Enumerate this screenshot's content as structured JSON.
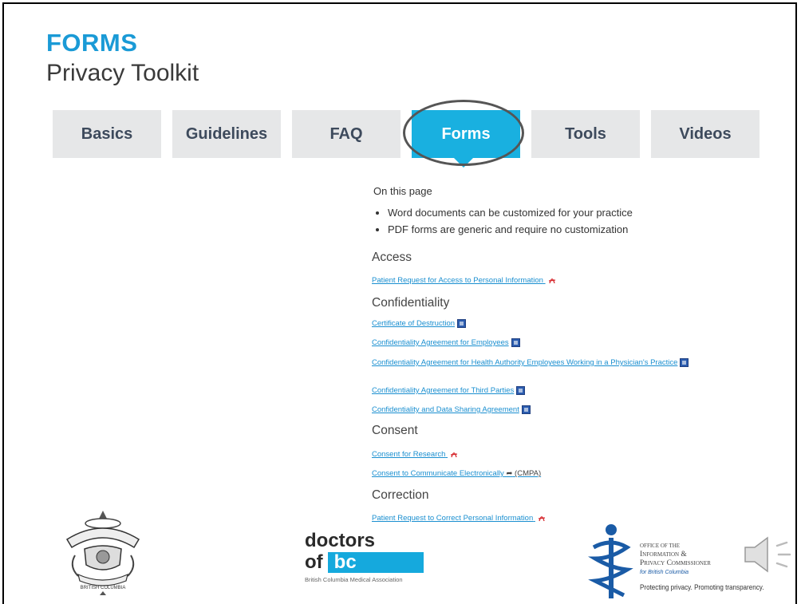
{
  "header": {
    "title": "FORMS",
    "subtitle": "Privacy Toolkit"
  },
  "tabs": [
    {
      "label": "Basics",
      "active": false
    },
    {
      "label": "Guidelines",
      "active": false
    },
    {
      "label": "FAQ",
      "active": false
    },
    {
      "label": "Forms",
      "active": true
    },
    {
      "label": "Tools",
      "active": false
    },
    {
      "label": "Videos",
      "active": false
    }
  ],
  "content": {
    "on_this_page": "On this page",
    "bullets": [
      "Word documents can be customized for your practice",
      "PDF forms are generic and require no customization"
    ],
    "sections": {
      "access": {
        "heading": "Access",
        "links": [
          "Patient Request for Access to Personal Information"
        ]
      },
      "confidentiality": {
        "heading": "Confidentiality",
        "links": [
          "Certificate of Destruction",
          "Confidentiality Agreement for Employees",
          "Confidentiality Agreement for Health Authority Employees Working in a Physician's Practice",
          "Confidentiality Agreement for Third Parties",
          "Confidentiality and Data Sharing Agreement"
        ]
      },
      "consent": {
        "heading": "Consent",
        "links": [
          "Consent for Research",
          "Consent to Communicate Electronically"
        ],
        "cmpa_note": "(CMPA)"
      },
      "correction": {
        "heading": "Correction",
        "links": [
          "Patient Request to Correct Personal Information"
        ]
      }
    }
  },
  "logos": {
    "doctors_line1": "doctors",
    "doctors_of": "of",
    "doctors_bc": "bc",
    "bcma": "British Columbia Medical Association",
    "oipc_line1": "Office of the",
    "oipc_line2": "Information &",
    "oipc_line3": "Privacy Commissioner",
    "oipc_line4": "for British Columbia",
    "oipc_tagline": "Protecting privacy. Promoting transparency.",
    "cpsbc_label": "BRITISH COLUMBIA"
  },
  "colors": {
    "accent": "#19b0e0",
    "title": "#1a9ad6",
    "link": "#1a8fd0",
    "tab_bg": "#e6e7e8"
  },
  "icons": {
    "pdf": "pdf-icon",
    "word": "word-doc-icon",
    "external": "external-link-icon",
    "audio": "speaker-icon"
  }
}
